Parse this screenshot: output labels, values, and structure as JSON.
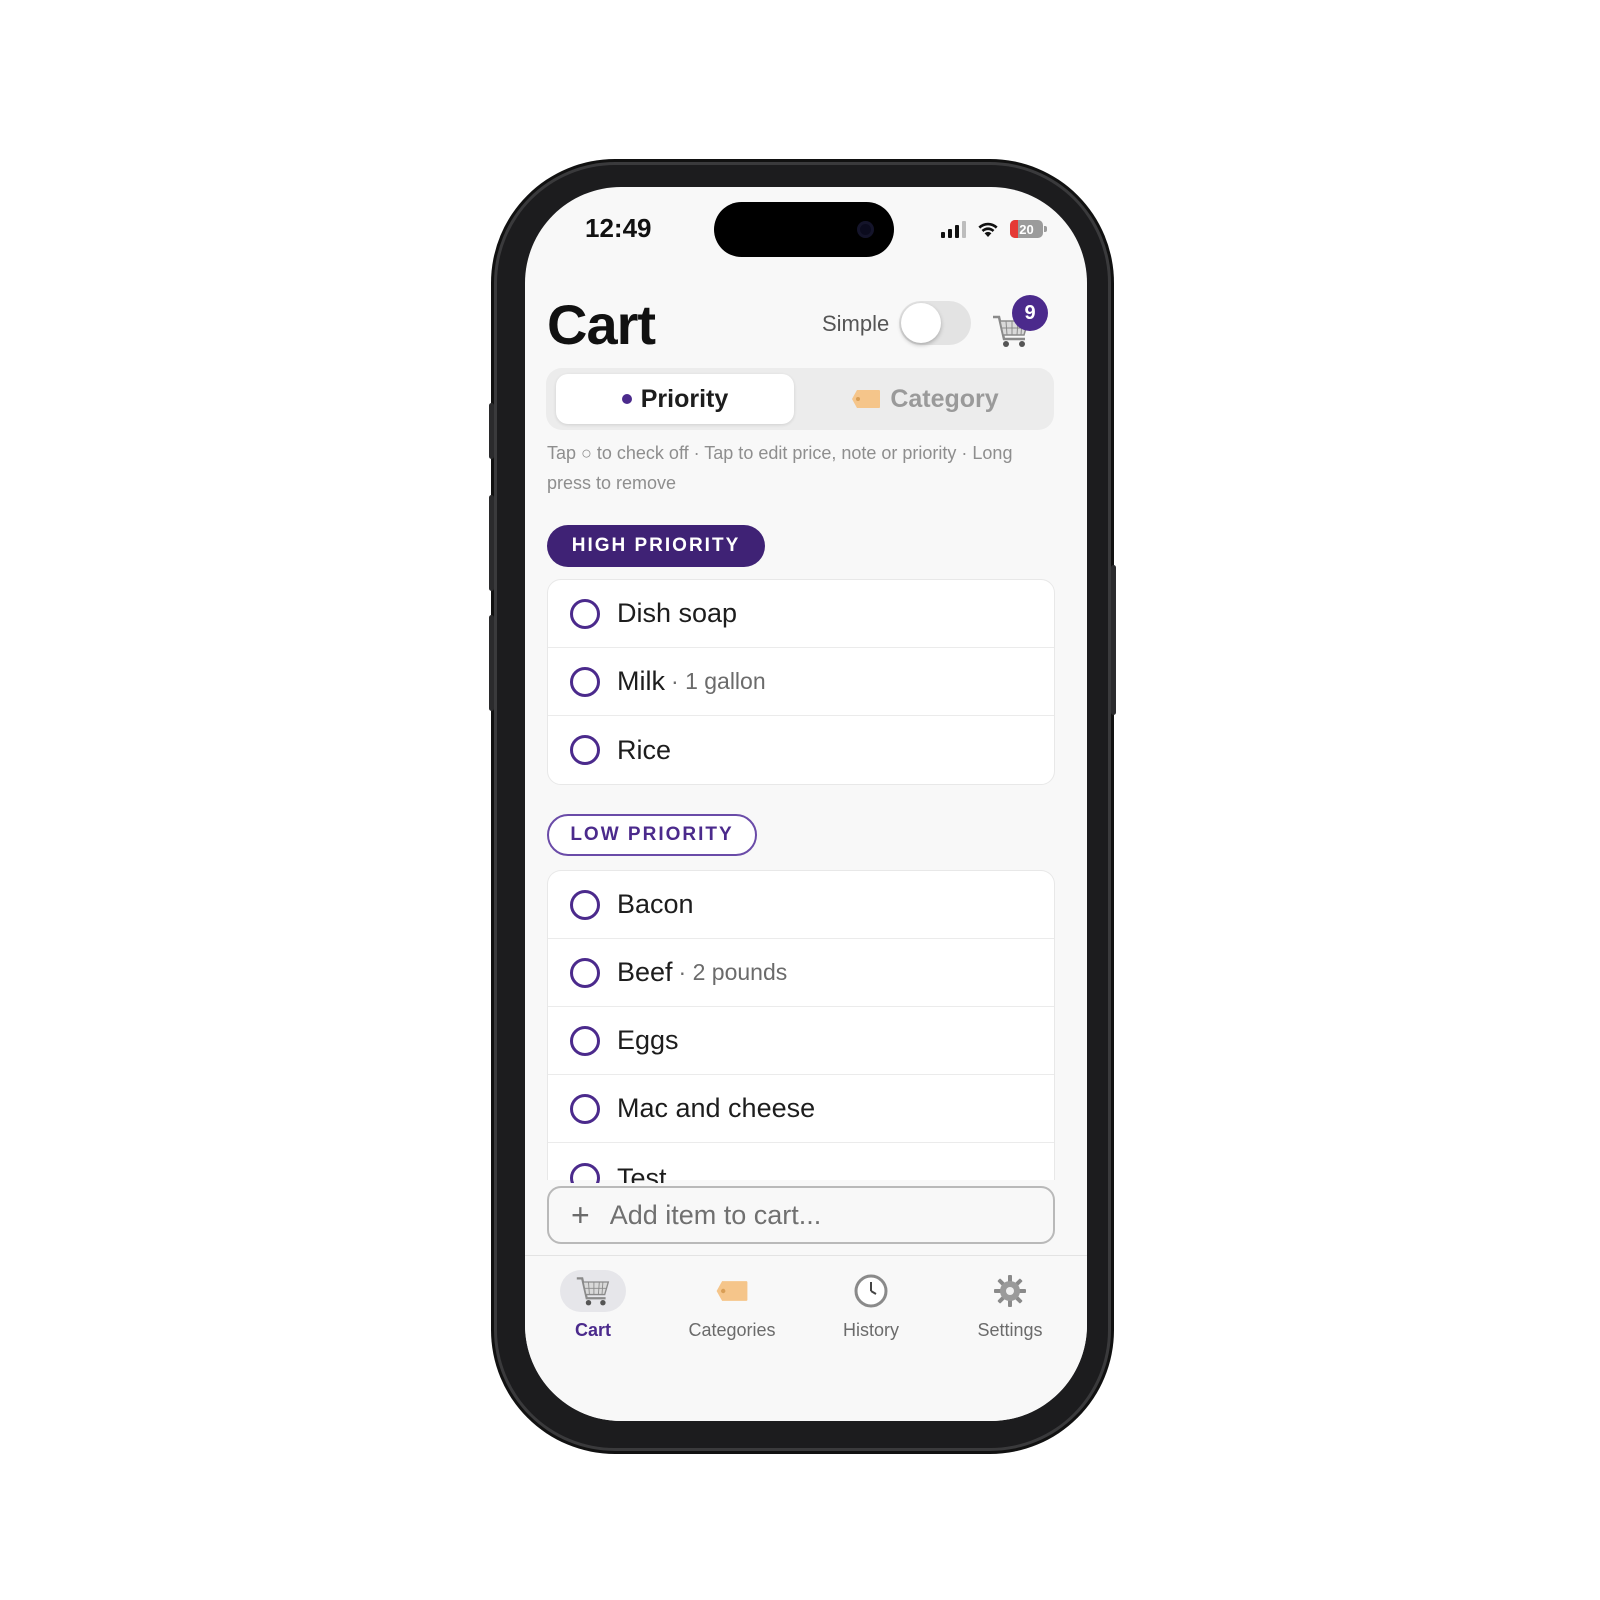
{
  "status": {
    "time": "12:49",
    "battery": "20"
  },
  "header": {
    "title": "Cart",
    "simple_label": "Simple",
    "simple_on": false,
    "cart_count": "9"
  },
  "segments": [
    {
      "label": "Priority",
      "icon": "dot-icon",
      "active": true
    },
    {
      "label": "Category",
      "icon": "tag-icon",
      "active": false
    }
  ],
  "help_text": "Tap ○ to check off · Tap to edit price, note or priority · Long press to remove",
  "sections": {
    "high": {
      "label": "HIGH PRIORITY",
      "items": [
        {
          "name": "Dish soap",
          "note": ""
        },
        {
          "name": "Milk",
          "note": "1 gallon"
        },
        {
          "name": "Rice",
          "note": ""
        }
      ]
    },
    "low": {
      "label": "LOW PRIORITY",
      "items": [
        {
          "name": "Bacon",
          "note": ""
        },
        {
          "name": "Beef",
          "note": "2 pounds"
        },
        {
          "name": "Eggs",
          "note": ""
        },
        {
          "name": "Mac and cheese",
          "note": ""
        },
        {
          "name": "Test",
          "note": ""
        }
      ]
    }
  },
  "add_item": {
    "placeholder": "Add item to cart..."
  },
  "tabs": [
    {
      "label": "Cart",
      "icon": "cart-icon",
      "active": true
    },
    {
      "label": "Categories",
      "icon": "tag-icon",
      "active": false
    },
    {
      "label": "History",
      "icon": "clock-icon",
      "active": false
    },
    {
      "label": "Settings",
      "icon": "gear-icon",
      "active": false
    }
  ],
  "colors": {
    "accent": "#4b2a8c",
    "high_pill": "#3f2275",
    "tag": "#f5c58a"
  }
}
